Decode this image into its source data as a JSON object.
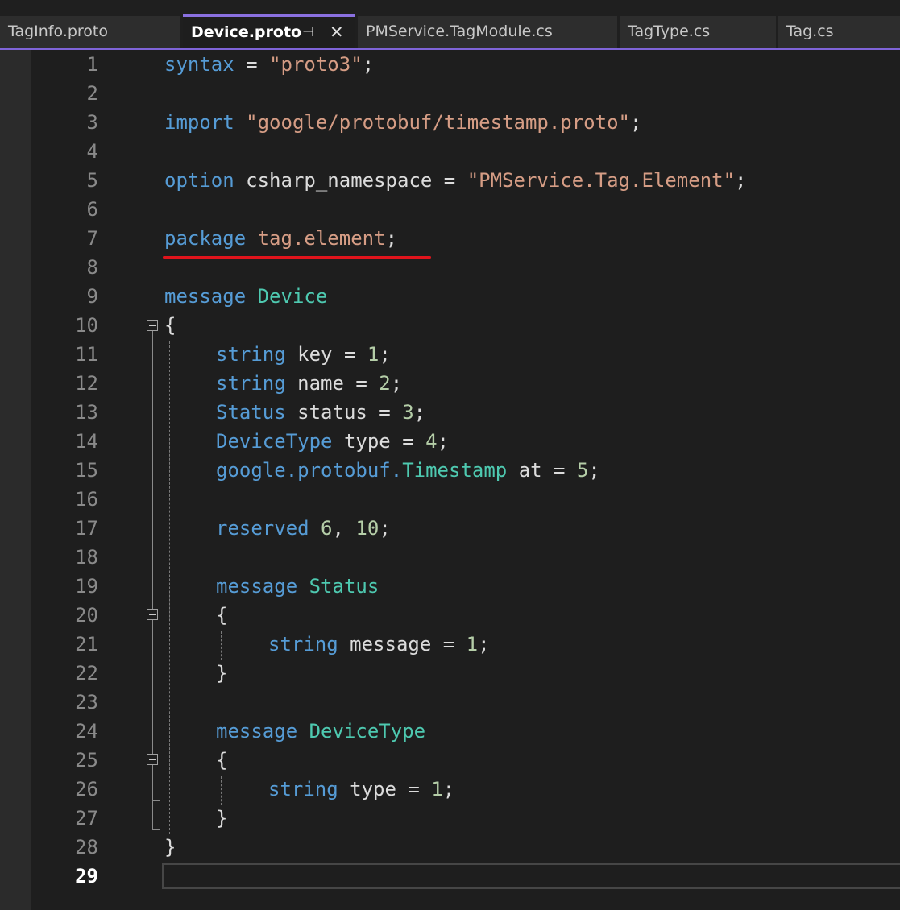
{
  "tabs": [
    {
      "label": "TagInfo.proto"
    },
    {
      "label": "Device.proto",
      "pin": "⊣",
      "close": "✕"
    },
    {
      "label": "PMService.TagModule.cs"
    },
    {
      "label": "TagType.cs"
    },
    {
      "label": "Tag.cs"
    }
  ],
  "line_numbers": [
    "1",
    "2",
    "3",
    "4",
    "5",
    "6",
    "7",
    "8",
    "9",
    "10",
    "11",
    "12",
    "13",
    "14",
    "15",
    "16",
    "17",
    "18",
    "19",
    "20",
    "21",
    "22",
    "23",
    "24",
    "25",
    "26",
    "27",
    "28",
    "29"
  ],
  "current_line": "29",
  "code": {
    "l1": {
      "kw": "syntax",
      "eq": " = ",
      "str": "\"proto3\"",
      "end": ";"
    },
    "l3": {
      "kw": "import",
      "str": "\"google/protobuf/timestamp.proto\"",
      "end": ";"
    },
    "l5": {
      "kw": "option",
      "name": "csharp_namespace",
      "eq": " = ",
      "str": "\"PMService.Tag.Element\"",
      "end": ";"
    },
    "l7": {
      "kw": "package",
      "name": "tag.element",
      "end": ";"
    },
    "l9": {
      "kw": "message",
      "type": "Device"
    },
    "l10": {
      "text": "{"
    },
    "l11": {
      "kw": "string",
      "rest": " key = ",
      "num": "1",
      "end": ";"
    },
    "l12": {
      "kw": "string",
      "rest": " name = ",
      "num": "2",
      "end": ";"
    },
    "l13": {
      "kw": "Status",
      "rest": " status = ",
      "num": "3",
      "end": ";"
    },
    "l14": {
      "kw": "DeviceType",
      "rest": " type = ",
      "num": "4",
      "end": ";"
    },
    "l15": {
      "kw1": "google",
      "dot1": ".",
      "kw2": "protobuf",
      "dot2": ".",
      "type": "Timestamp",
      "rest": " at = ",
      "num": "5",
      "end": ";"
    },
    "l17": {
      "kw": "reserved",
      "num1": "6",
      "sep": ", ",
      "num2": "10",
      "end": ";"
    },
    "l19": {
      "kw": "message",
      "type": "Status"
    },
    "l20": {
      "text": "{"
    },
    "l21": {
      "kw": "string",
      "rest": " message = ",
      "num": "1",
      "end": ";"
    },
    "l22": {
      "text": "}"
    },
    "l24": {
      "kw": "message",
      "type": "DeviceType"
    },
    "l25": {
      "text": "{"
    },
    "l26": {
      "kw": "string",
      "rest": " type = ",
      "num": "1",
      "end": ";"
    },
    "l27": {
      "text": "}"
    },
    "l28": {
      "text": "}"
    }
  },
  "colors": {
    "keyword": "#569cd6",
    "string": "#d69d85",
    "number": "#b5cea8",
    "type": "#4ec9b0",
    "text": "#dcdcdc",
    "underline": "#e0141c",
    "active_tab_accent": "#8a70e0"
  }
}
